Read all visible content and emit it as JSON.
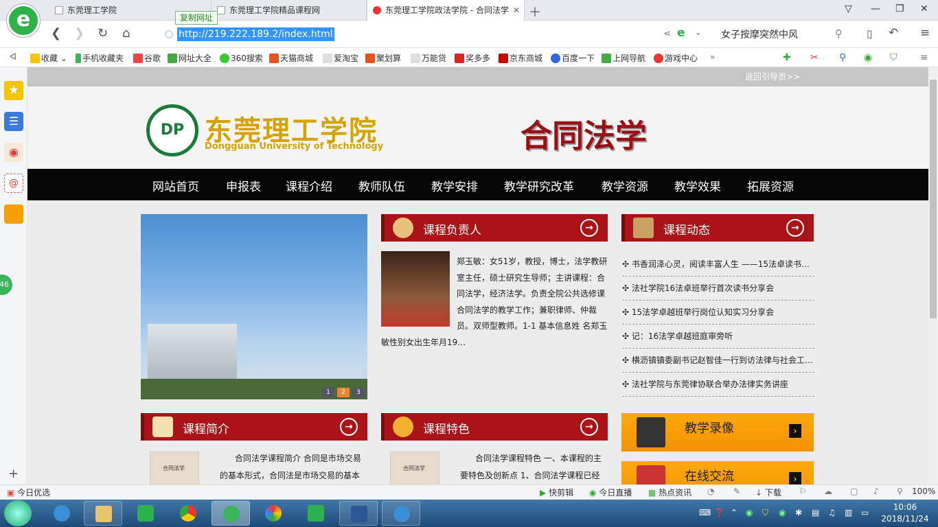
{
  "browser": {
    "tabs": [
      {
        "label": "东莞理工学院"
      },
      {
        "label": "东莞理工学院精品课程网"
      },
      {
        "label": "东莞理工学院政法学院 - 合同法学"
      }
    ],
    "copy_url_label": "复制网址",
    "url": "http://219.222.189.2/index.html",
    "search_text": "女子按摩突然中风"
  },
  "bookmarks": [
    "收藏",
    "手机收藏夹",
    "谷歌",
    "网址大全",
    "360搜索",
    "天猫商城",
    "爱淘宝",
    "聚划算",
    "万能贷",
    "奖多多",
    "京东商城",
    "百度一下",
    "上网导航",
    "游戏中心"
  ],
  "sidebar_badge": "46",
  "site": {
    "back_link": "返回引导页>>",
    "school_name": "东莞理工学院",
    "school_name_en": "Dongguan University of Technology",
    "page_title": "合同法学",
    "nav": [
      "网站首页",
      "申报表",
      "课程介绍",
      "教师队伍",
      "教学安排",
      "教学研究改革",
      "教学资源",
      "教学效果",
      "拓展资源"
    ],
    "slider_dots": [
      "1",
      "2",
      "3"
    ],
    "leader": {
      "title": "课程负责人",
      "bio": "郑玉敏：女51岁，教授，博士，法学教研室主任，硕士研究生导师；主讲课程：合同法学，经济法学。负责全院公共选修课合同法学的教学工作；兼职律师、仲裁员。双师型教师。1-1 基本信息姓  名郑玉敏性别女出生年月19…"
    },
    "news": {
      "title": "课程动态",
      "items": [
        "书香润泽心灵，阅读丰富人生 ——15法卓读书会…",
        "法社学院16法卓班举行首次读书分享会",
        "15法学卓越班举行岗位认知实习分享会",
        "记：16法学卓越班庭审旁听",
        "横沥镇镇委副书记赵智佳一行到访法律与社会工…",
        "法社学院与东莞律协联合举办法律实务讲座"
      ]
    },
    "intro": {
      "title": "课程简介",
      "text": "合同法学课程简介 合同是市场交易的基本形式，合同法是市场交易的基本"
    },
    "feature": {
      "title": "课程特色",
      "text": "合同法学课程特色 一、本课程的主要特色及创新点 1、合同法学课程已经"
    },
    "thumb_label": "合同法学",
    "video": "教学录像",
    "online": "在线交流"
  },
  "statusbar": {
    "left": "今日优选",
    "items": [
      "快剪辑",
      "今日直播",
      "热点资讯",
      "下载"
    ],
    "zoom": "100%"
  },
  "taskbar": {
    "time": "10:06",
    "date": "2018/11/24"
  }
}
